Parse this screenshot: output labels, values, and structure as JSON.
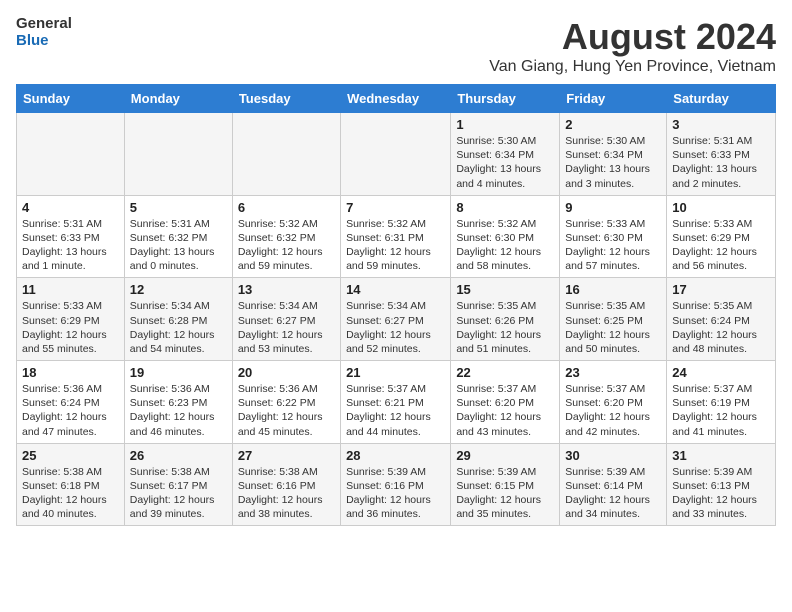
{
  "header": {
    "logo_line1": "General",
    "logo_line2": "Blue",
    "month_year": "August 2024",
    "location": "Van Giang, Hung Yen Province, Vietnam"
  },
  "weekdays": [
    "Sunday",
    "Monday",
    "Tuesday",
    "Wednesday",
    "Thursday",
    "Friday",
    "Saturday"
  ],
  "weeks": [
    [
      {
        "day": "",
        "info": ""
      },
      {
        "day": "",
        "info": ""
      },
      {
        "day": "",
        "info": ""
      },
      {
        "day": "",
        "info": ""
      },
      {
        "day": "1",
        "info": "Sunrise: 5:30 AM\nSunset: 6:34 PM\nDaylight: 13 hours and 4 minutes."
      },
      {
        "day": "2",
        "info": "Sunrise: 5:30 AM\nSunset: 6:34 PM\nDaylight: 13 hours and 3 minutes."
      },
      {
        "day": "3",
        "info": "Sunrise: 5:31 AM\nSunset: 6:33 PM\nDaylight: 13 hours and 2 minutes."
      }
    ],
    [
      {
        "day": "4",
        "info": "Sunrise: 5:31 AM\nSunset: 6:33 PM\nDaylight: 13 hours and 1 minute."
      },
      {
        "day": "5",
        "info": "Sunrise: 5:31 AM\nSunset: 6:32 PM\nDaylight: 13 hours and 0 minutes."
      },
      {
        "day": "6",
        "info": "Sunrise: 5:32 AM\nSunset: 6:32 PM\nDaylight: 12 hours and 59 minutes."
      },
      {
        "day": "7",
        "info": "Sunrise: 5:32 AM\nSunset: 6:31 PM\nDaylight: 12 hours and 59 minutes."
      },
      {
        "day": "8",
        "info": "Sunrise: 5:32 AM\nSunset: 6:30 PM\nDaylight: 12 hours and 58 minutes."
      },
      {
        "day": "9",
        "info": "Sunrise: 5:33 AM\nSunset: 6:30 PM\nDaylight: 12 hours and 57 minutes."
      },
      {
        "day": "10",
        "info": "Sunrise: 5:33 AM\nSunset: 6:29 PM\nDaylight: 12 hours and 56 minutes."
      }
    ],
    [
      {
        "day": "11",
        "info": "Sunrise: 5:33 AM\nSunset: 6:29 PM\nDaylight: 12 hours and 55 minutes."
      },
      {
        "day": "12",
        "info": "Sunrise: 5:34 AM\nSunset: 6:28 PM\nDaylight: 12 hours and 54 minutes."
      },
      {
        "day": "13",
        "info": "Sunrise: 5:34 AM\nSunset: 6:27 PM\nDaylight: 12 hours and 53 minutes."
      },
      {
        "day": "14",
        "info": "Sunrise: 5:34 AM\nSunset: 6:27 PM\nDaylight: 12 hours and 52 minutes."
      },
      {
        "day": "15",
        "info": "Sunrise: 5:35 AM\nSunset: 6:26 PM\nDaylight: 12 hours and 51 minutes."
      },
      {
        "day": "16",
        "info": "Sunrise: 5:35 AM\nSunset: 6:25 PM\nDaylight: 12 hours and 50 minutes."
      },
      {
        "day": "17",
        "info": "Sunrise: 5:35 AM\nSunset: 6:24 PM\nDaylight: 12 hours and 48 minutes."
      }
    ],
    [
      {
        "day": "18",
        "info": "Sunrise: 5:36 AM\nSunset: 6:24 PM\nDaylight: 12 hours and 47 minutes."
      },
      {
        "day": "19",
        "info": "Sunrise: 5:36 AM\nSunset: 6:23 PM\nDaylight: 12 hours and 46 minutes."
      },
      {
        "day": "20",
        "info": "Sunrise: 5:36 AM\nSunset: 6:22 PM\nDaylight: 12 hours and 45 minutes."
      },
      {
        "day": "21",
        "info": "Sunrise: 5:37 AM\nSunset: 6:21 PM\nDaylight: 12 hours and 44 minutes."
      },
      {
        "day": "22",
        "info": "Sunrise: 5:37 AM\nSunset: 6:20 PM\nDaylight: 12 hours and 43 minutes."
      },
      {
        "day": "23",
        "info": "Sunrise: 5:37 AM\nSunset: 6:20 PM\nDaylight: 12 hours and 42 minutes."
      },
      {
        "day": "24",
        "info": "Sunrise: 5:37 AM\nSunset: 6:19 PM\nDaylight: 12 hours and 41 minutes."
      }
    ],
    [
      {
        "day": "25",
        "info": "Sunrise: 5:38 AM\nSunset: 6:18 PM\nDaylight: 12 hours and 40 minutes."
      },
      {
        "day": "26",
        "info": "Sunrise: 5:38 AM\nSunset: 6:17 PM\nDaylight: 12 hours and 39 minutes."
      },
      {
        "day": "27",
        "info": "Sunrise: 5:38 AM\nSunset: 6:16 PM\nDaylight: 12 hours and 38 minutes."
      },
      {
        "day": "28",
        "info": "Sunrise: 5:39 AM\nSunset: 6:16 PM\nDaylight: 12 hours and 36 minutes."
      },
      {
        "day": "29",
        "info": "Sunrise: 5:39 AM\nSunset: 6:15 PM\nDaylight: 12 hours and 35 minutes."
      },
      {
        "day": "30",
        "info": "Sunrise: 5:39 AM\nSunset: 6:14 PM\nDaylight: 12 hours and 34 minutes."
      },
      {
        "day": "31",
        "info": "Sunrise: 5:39 AM\nSunset: 6:13 PM\nDaylight: 12 hours and 33 minutes."
      }
    ]
  ]
}
